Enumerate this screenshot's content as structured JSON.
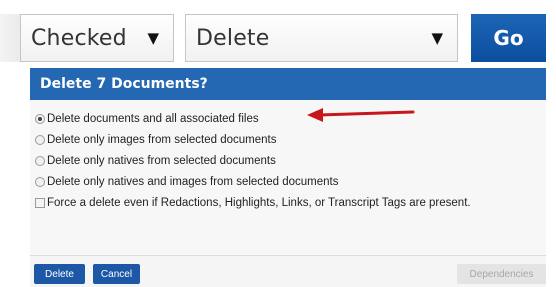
{
  "toolbar": {
    "scope_select_value": "Checked",
    "action_select_value": "Delete",
    "dropdown_arrow": "▼",
    "go_label": "Go"
  },
  "dialog": {
    "title": "Delete 7 Documents?",
    "options": [
      {
        "label": "Delete documents and all associated files",
        "type": "radio",
        "checked": true
      },
      {
        "label": "Delete only images from selected documents",
        "type": "radio",
        "checked": false
      },
      {
        "label": "Delete only natives from selected documents",
        "type": "radio",
        "checked": false
      },
      {
        "label": "Delete only natives and images from selected documents",
        "type": "radio",
        "checked": false
      },
      {
        "label": "Force a delete even if Redactions, Highlights, Links, or Transcript Tags are present.",
        "type": "checkbox",
        "checked": false
      }
    ],
    "footer": {
      "delete_label": "Delete",
      "cancel_label": "Cancel",
      "dependencies_label": "Dependencies"
    }
  },
  "colors": {
    "header_blue": "#2467b3",
    "button_blue": "#1c58a6",
    "go_blue": "#0b4ea0",
    "annotation_red": "#c8161d"
  },
  "icons": {
    "annotation": "red-arrow-icon",
    "dropdown": "chevron-down-icon"
  }
}
